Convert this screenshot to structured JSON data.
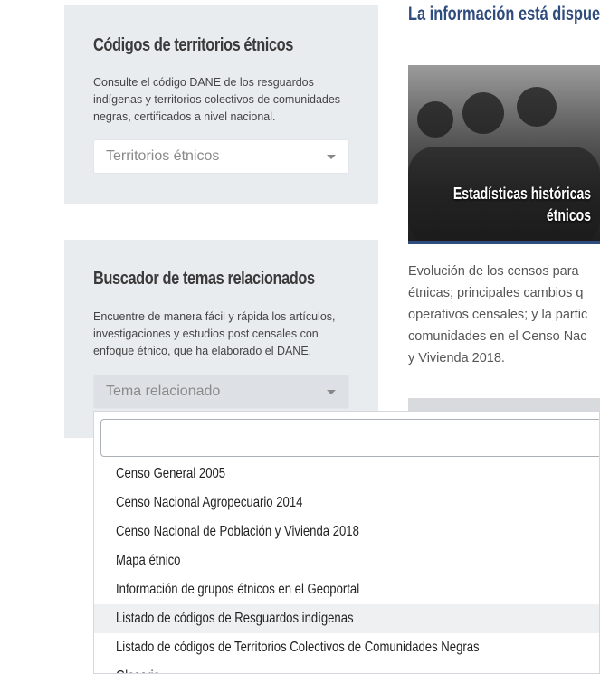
{
  "panel1": {
    "title": "Códigos de territorios étnicos",
    "description": "Consulte el código DANE de los resguardos indígenas y territorios colectivos de comunidades negras, certificados a nivel nacional.",
    "select_value": "Territorios étnicos"
  },
  "panel2": {
    "title": "Buscador de temas relacionados",
    "description": "Encuentre de manera fácil y rápida los artículos, investigaciones y estudios post censales con enfoque étnico, que ha elaborado el DANE.",
    "select_value": "Tema relacionado"
  },
  "right": {
    "title": "La información está dispue",
    "hero_caption_line1": "Estadísticas históricas",
    "hero_caption_line2": "étnicos",
    "description_lines": [
      "Evolución de los censos para",
      "étnicas; principales cambios q",
      "operativos censales; y la partic",
      "comunidades en el Censo Nac",
      "y Vivienda 2018."
    ]
  },
  "dropdown": {
    "search_value": "",
    "items": [
      "Censo General 2005",
      "Censo Nacional Agropecuario 2014",
      "Censo Nacional de Población y Vivienda 2018",
      "Mapa étnico",
      "Información de grupos étnicos en el Geoportal",
      "Listado de códigos de Resguardos indígenas",
      "Listado de códigos de Territorios Colectivos de Comunidades Negras",
      "Glosario"
    ],
    "highlighted_index": 5
  }
}
